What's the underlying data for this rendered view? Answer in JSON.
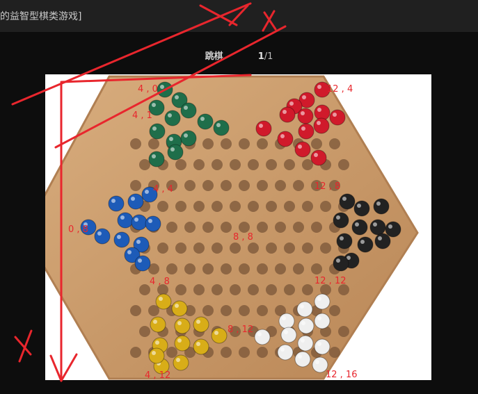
{
  "header": {
    "title": "的益智型棋类游戏]"
  },
  "caption": {
    "name": "跳棋",
    "current": "1",
    "total": "/1"
  },
  "board": {
    "colors": {
      "wood": "#c99a6a",
      "wood_edge": "#b07f52",
      "hole": "#7a5638",
      "green": "#1f6e4a",
      "red": "#d01a2b",
      "blue": "#1d5bb8",
      "black": "#222222",
      "yellow": "#d8ad18",
      "white": "#efefef"
    }
  },
  "annotations": {
    "labels": [
      "4 , 0",
      "12 , 4",
      "4 , 1",
      "4 , 4",
      "12 , 8",
      "0 , 8",
      "8 , 8",
      "4 , 8",
      "12 , 12",
      "8 , 12",
      "4 , 12",
      "12 , 16"
    ],
    "x_axis": "X",
    "y_axis": "Y",
    "stroke_color": "#e8262d"
  }
}
